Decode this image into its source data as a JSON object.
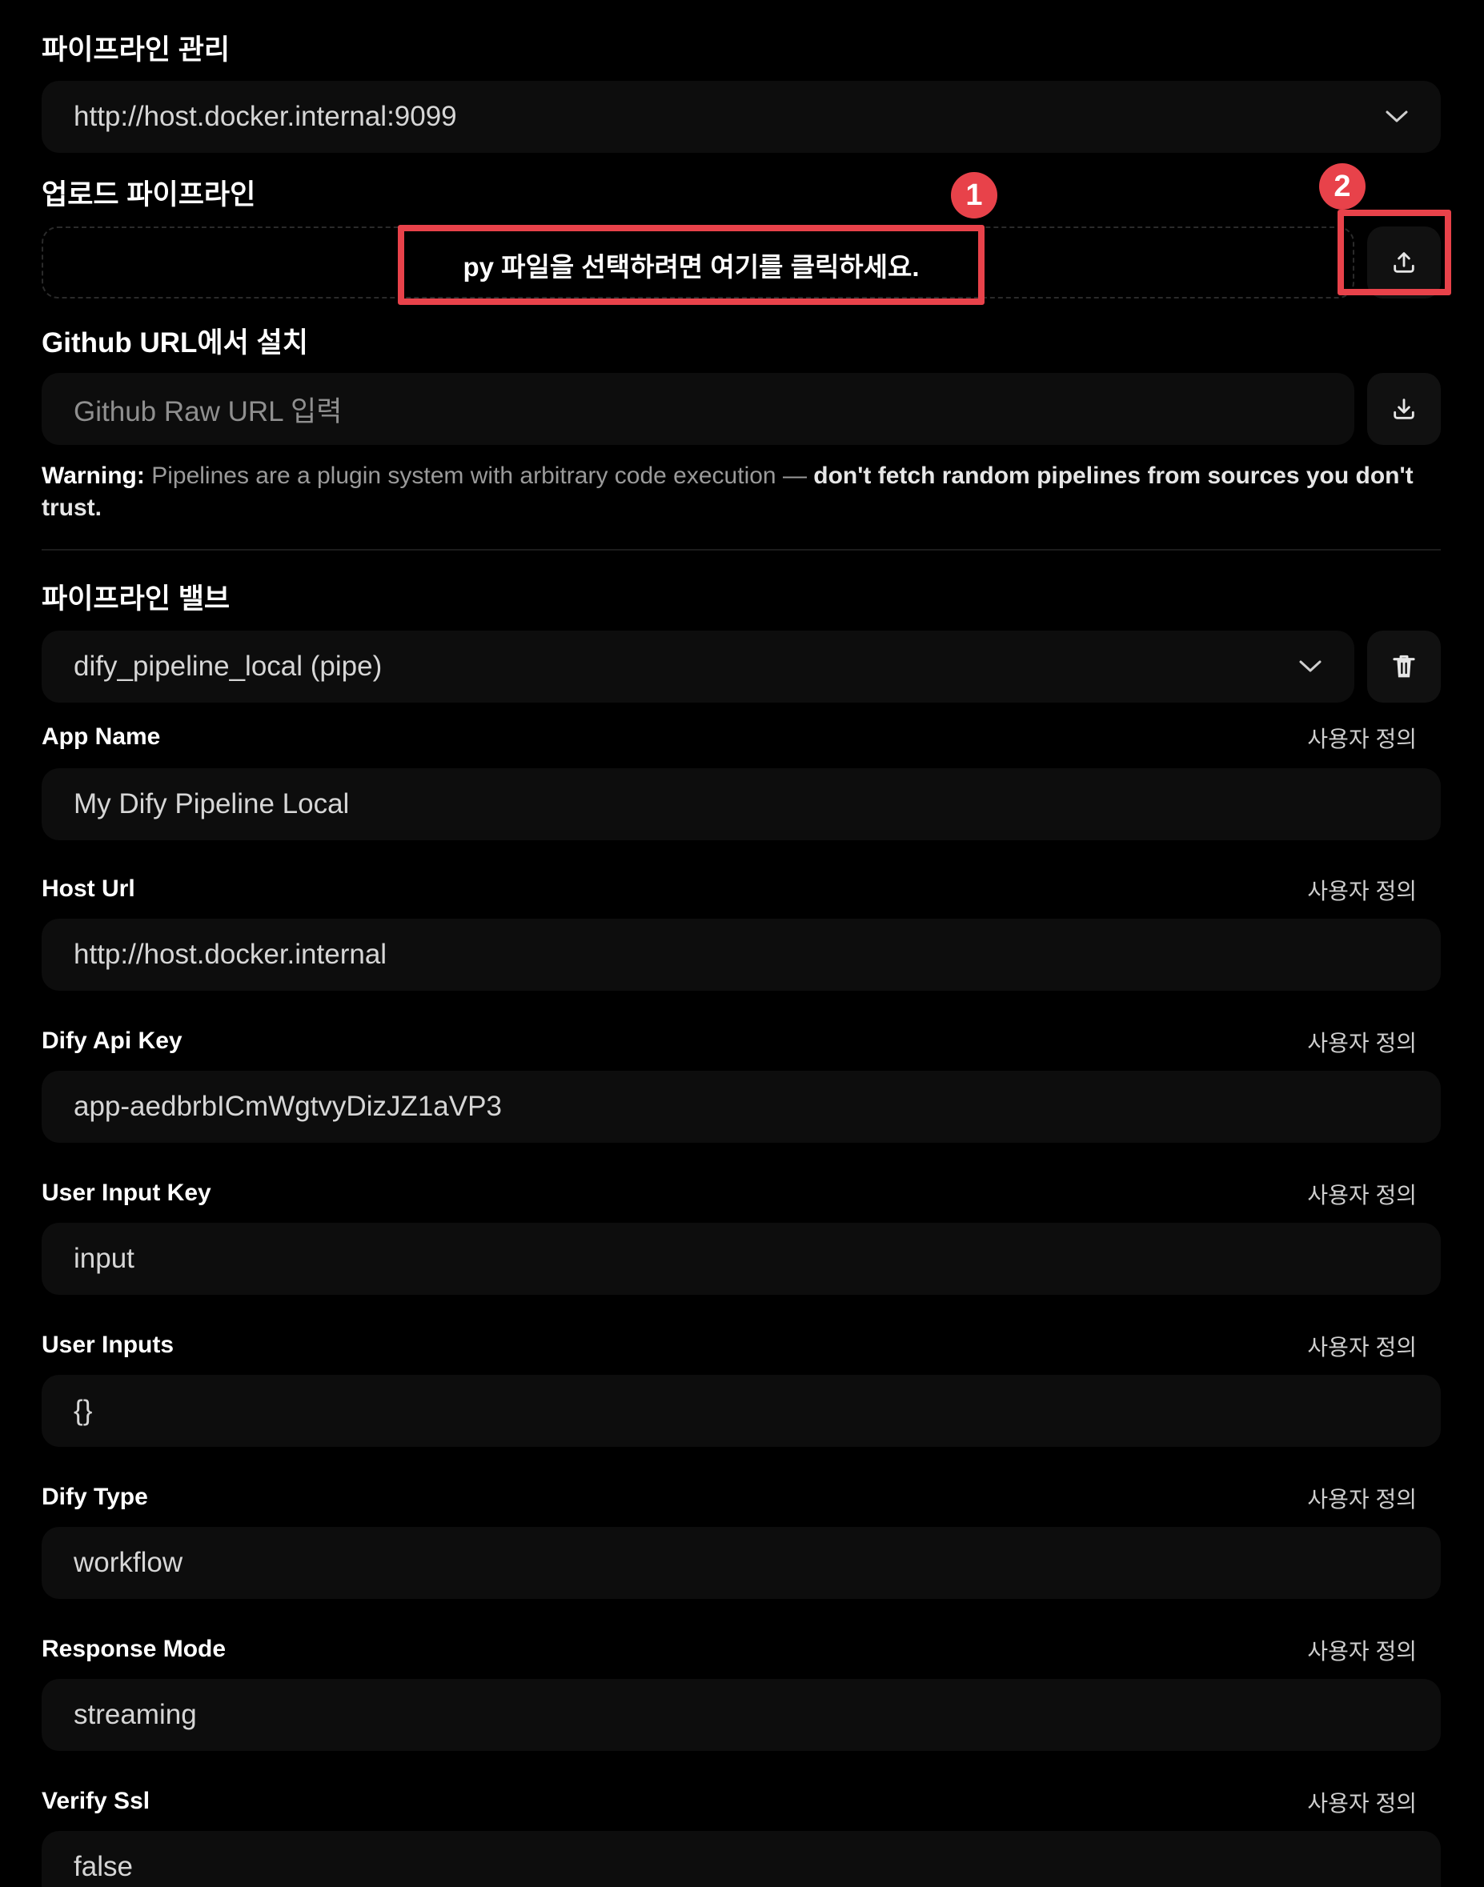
{
  "manage": {
    "title": "파이프라인 관리",
    "selected_server": "http://host.docker.internal:9099"
  },
  "upload": {
    "title": "업로드 파이프라인",
    "prompt": "py 파일을 선택하려면 여기를 클릭하세요."
  },
  "annotations": {
    "badge1": "1",
    "badge2": "2",
    "color": "#e8424a"
  },
  "github": {
    "title": "Github URL에서 설치",
    "placeholder": "Github Raw URL 입력"
  },
  "warning": {
    "label": "Warning:",
    "text": " Pipelines are a plugin system with arbitrary code execution — ",
    "emphasis": "don't fetch random pipelines from sources you don't trust."
  },
  "valves": {
    "title": "파이프라인 밸브",
    "selected_pipeline": "dify_pipeline_local (pipe)",
    "custom_label": "사용자 정의",
    "fields": [
      {
        "label": "App Name",
        "value": "My Dify Pipeline Local"
      },
      {
        "label": "Host Url",
        "value": "http://host.docker.internal"
      },
      {
        "label": "Dify Api Key",
        "value": "app-aedbrbICmWgtvyDizJZ1aVP3"
      },
      {
        "label": "User Input Key",
        "value": "input"
      },
      {
        "label": "User Inputs",
        "value": "{}"
      },
      {
        "label": "Dify Type",
        "value": "workflow"
      },
      {
        "label": "Response Mode",
        "value": "streaming"
      },
      {
        "label": "Verify Ssl",
        "value": "false"
      }
    ]
  },
  "icons": {
    "server_select": "chevron-down-icon",
    "upload": "upload-icon",
    "download": "download-icon",
    "pipeline_select": "chevron-down-icon",
    "delete": "trash-icon"
  }
}
